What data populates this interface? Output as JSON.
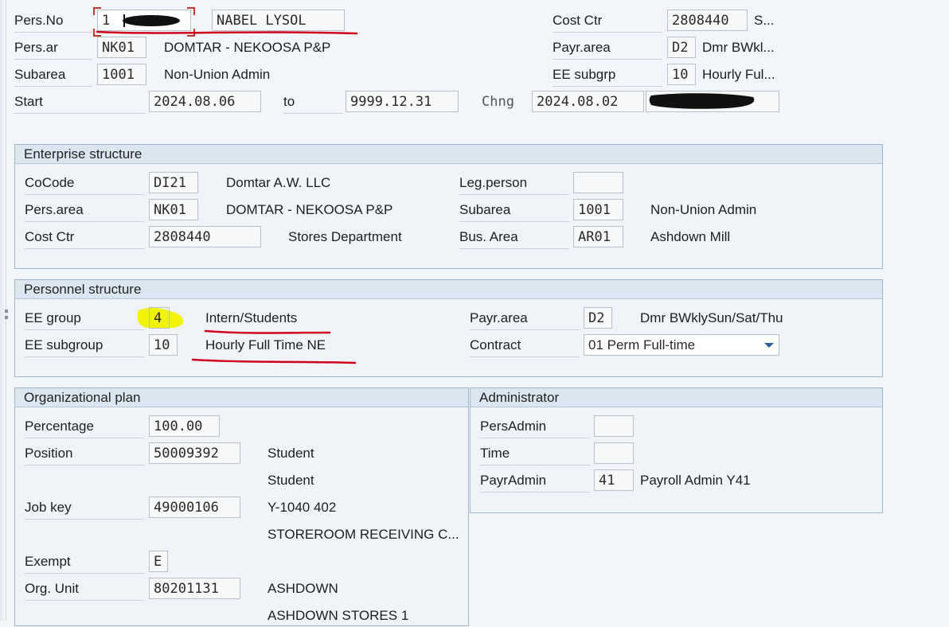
{
  "header": {
    "pers_no_label": "Pers.No",
    "pers_no_value": "1",
    "name": "NABEL LYSOL",
    "cost_ctr_label": "Cost Ctr",
    "cost_ctr_value": "2808440",
    "cost_ctr_text": "S...",
    "pers_ar_label": "Pers.ar",
    "pers_ar_value": "NK01",
    "pers_ar_text": "DOMTAR - NEKOOSA P&P",
    "payr_area_label": "Payr.area",
    "payr_area_value": "D2",
    "payr_area_text": "Dmr BWkl...",
    "subarea_label": "Subarea",
    "subarea_value": "1001",
    "subarea_text": "Non-Union Admin",
    "ee_subgrp_label": "EE subgrp",
    "ee_subgrp_value": "10",
    "ee_subgrp_text": "Hourly Ful...",
    "start_label": "Start",
    "start_value": "2024.08.06",
    "to_label": "to",
    "to_value": "9999.12.31",
    "chng_label": "Chng",
    "chng_value": "2024.08.02",
    "chng_user": ""
  },
  "enterprise": {
    "title": "Enterprise structure",
    "cocode_label": "CoCode",
    "cocode_value": "DI21",
    "cocode_text": "Domtar A.W. LLC",
    "leg_person_label": "Leg.person",
    "leg_person_value": "",
    "pers_area_label": "Pers.area",
    "pers_area_value": "NK01",
    "pers_area_text": "DOMTAR - NEKOOSA P&P",
    "subarea_label": "Subarea",
    "subarea_value": "1001",
    "subarea_text": "Non-Union Admin",
    "cost_ctr_label": "Cost Ctr",
    "cost_ctr_value": "2808440",
    "cost_ctr_text": "Stores Department",
    "bus_area_label": "Bus. Area",
    "bus_area_value": "AR01",
    "bus_area_text": "Ashdown Mill"
  },
  "personnel": {
    "title": "Personnel structure",
    "ee_group_label": "EE group",
    "ee_group_value": "4",
    "ee_group_text": "Intern/Students",
    "payr_area_label": "Payr.area",
    "payr_area_value": "D2",
    "payr_area_text": "Dmr BWklySun/Sat/Thu",
    "ee_subgroup_label": "EE subgroup",
    "ee_subgroup_value": "10",
    "ee_subgroup_text": "Hourly Full Time NE",
    "contract_label": "Contract",
    "contract_value": "01 Perm Full-time"
  },
  "org_plan": {
    "title": "Organizational plan",
    "percentage_label": "Percentage",
    "percentage_value": "100.00",
    "position_label": "Position",
    "position_value": "50009392",
    "position_text1": "Student",
    "position_text2": "Student",
    "job_key_label": "Job key",
    "job_key_value": "49000106",
    "job_key_text1": "Y-1040 402",
    "job_key_text2": "STOREROOM RECEIVING C...",
    "exempt_label": "Exempt",
    "exempt_value": "E",
    "org_unit_label": "Org. Unit",
    "org_unit_value": "80201131",
    "org_unit_text1": "ASHDOWN",
    "org_unit_text2": "ASHDOWN STORES 1"
  },
  "administrator": {
    "title": "Administrator",
    "pers_admin_label": "PersAdmin",
    "pers_admin_value": "",
    "time_label": "Time",
    "time_value": "",
    "payr_admin_label": "PayrAdmin",
    "payr_admin_value": "41",
    "payr_admin_text": "Payroll Admin Y41"
  },
  "colors": {
    "annotation_red": "#d0021b",
    "highlight_yellow": "#f2f20a",
    "group_border": "#9fb6cc",
    "group_header": "#dbe6f1"
  }
}
